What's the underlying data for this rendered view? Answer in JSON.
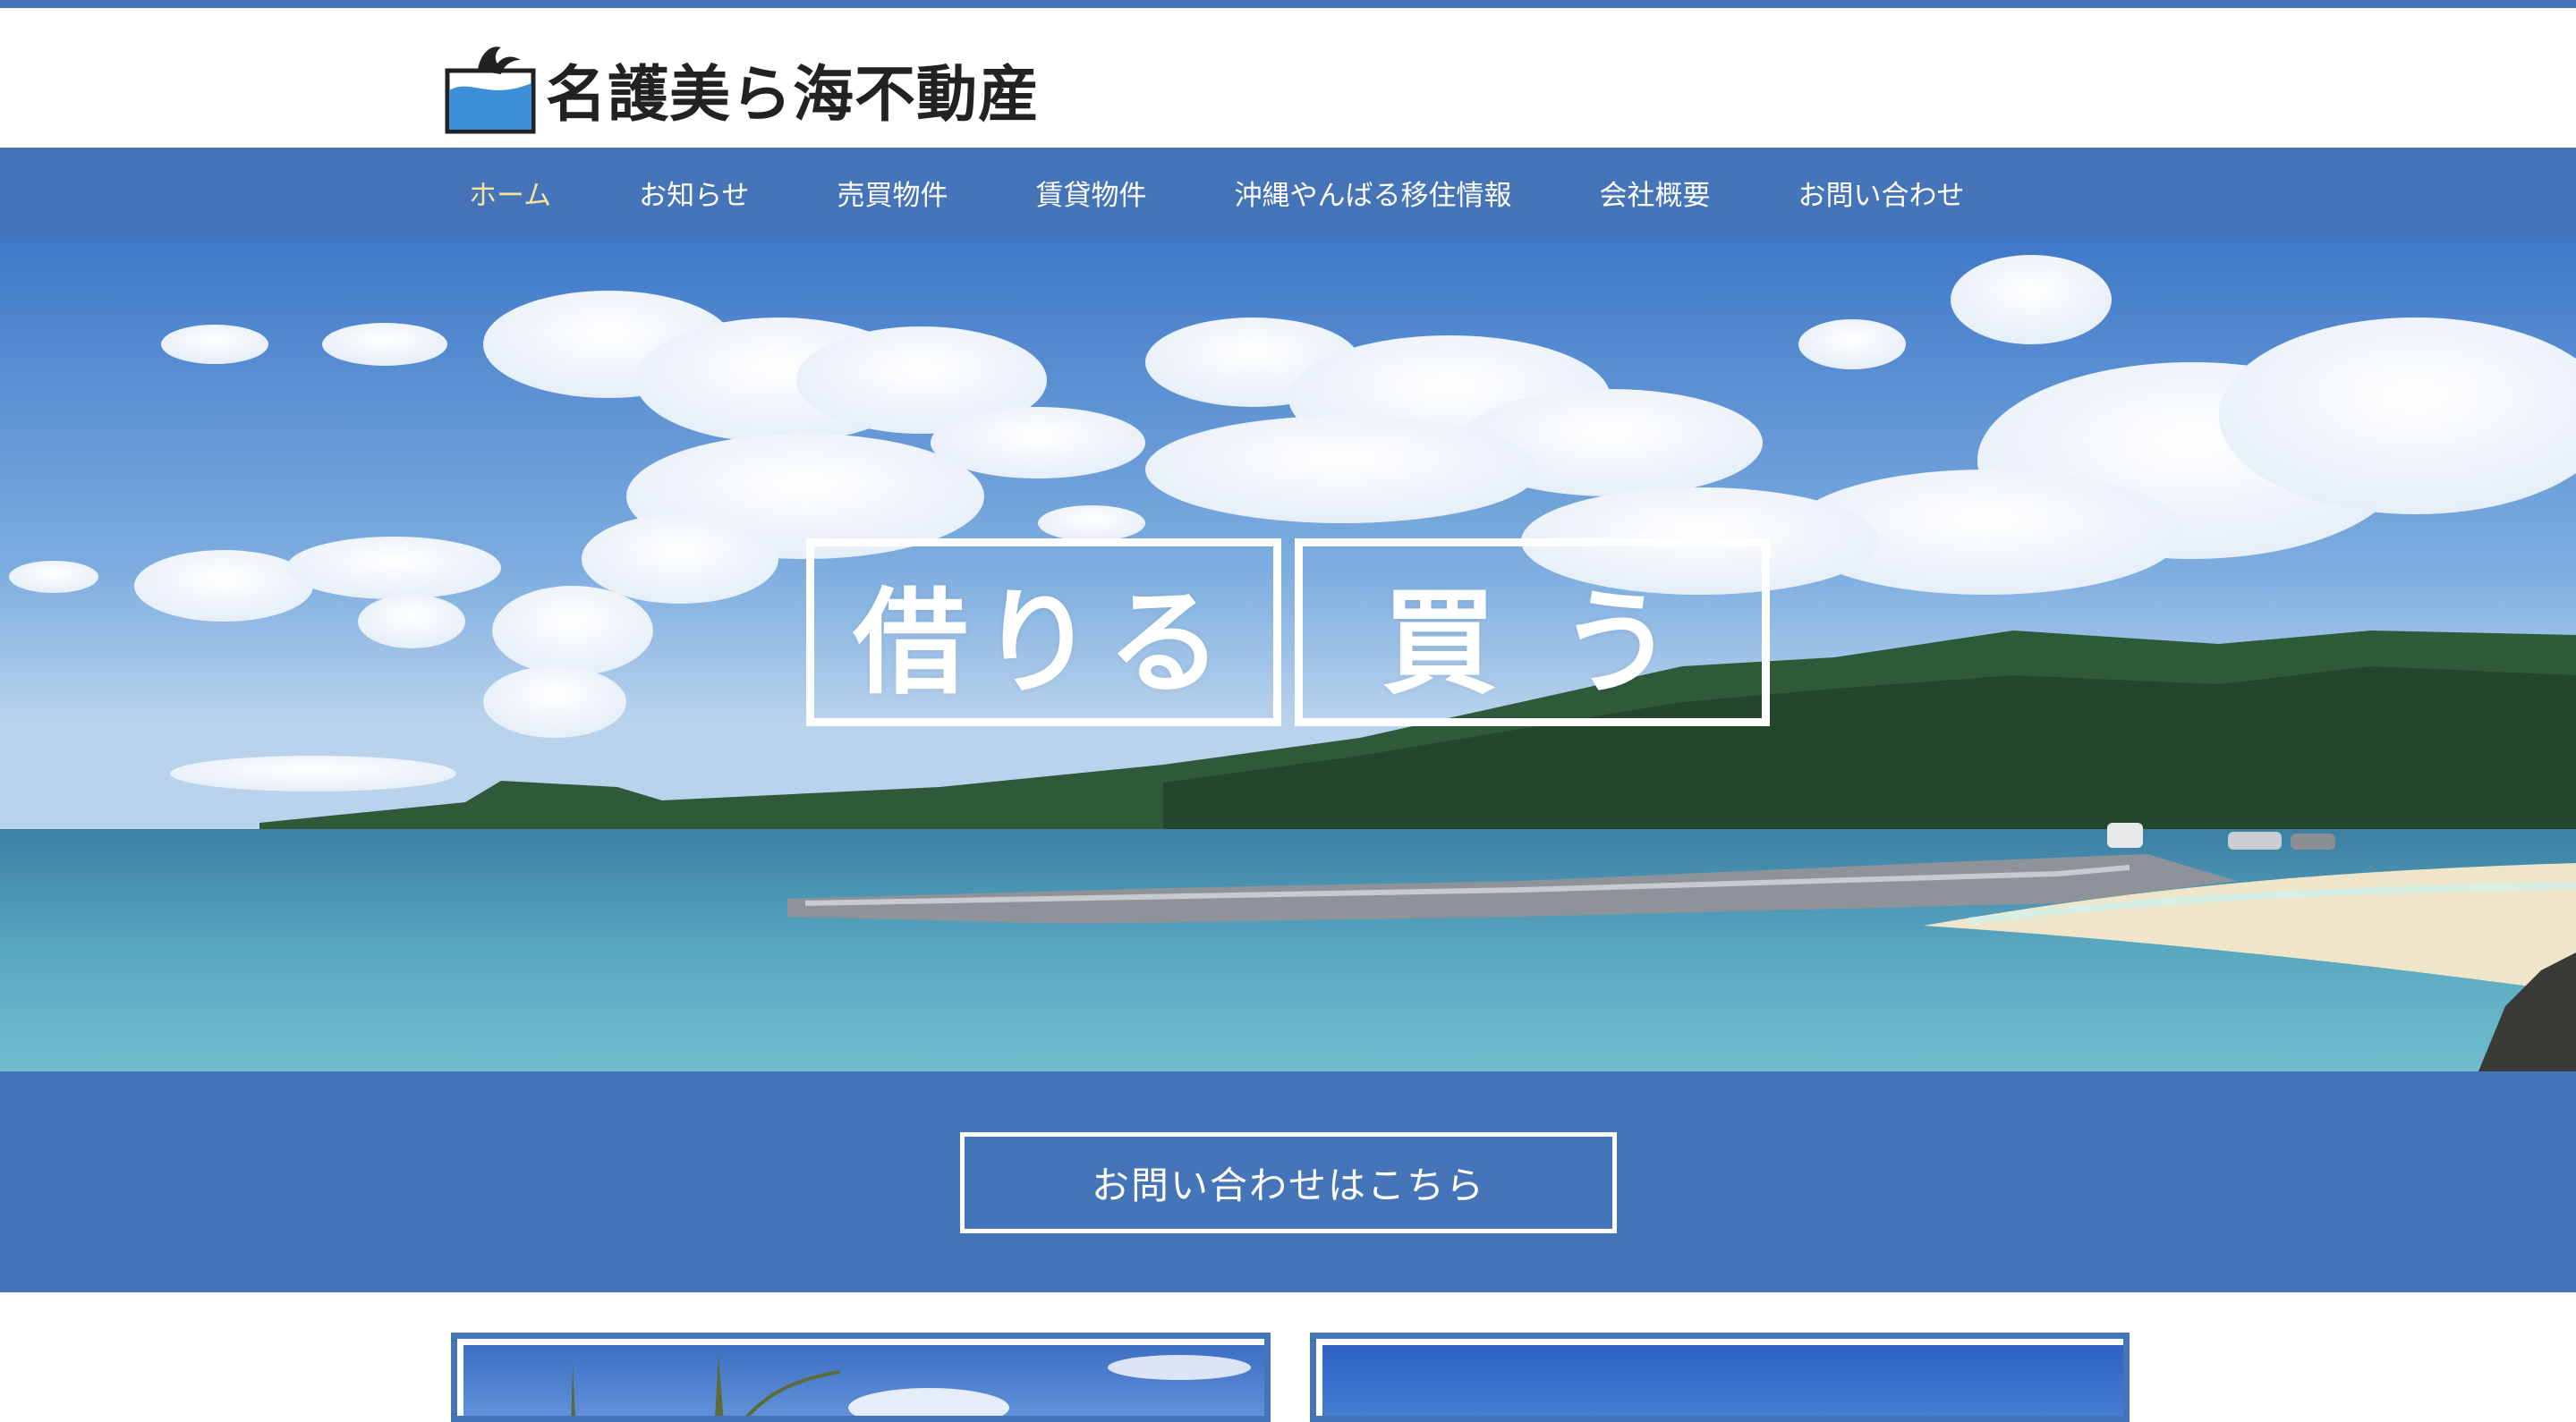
{
  "header": {
    "logo_text": "名護美ら海不動産"
  },
  "nav": {
    "items": [
      {
        "label": "ホーム",
        "active": true
      },
      {
        "label": "お知らせ",
        "active": false
      },
      {
        "label": "売買物件",
        "active": false
      },
      {
        "label": "賃貸物件",
        "active": false
      },
      {
        "label": "沖縄やんばる移住情報",
        "active": false
      },
      {
        "label": "会社概要",
        "active": false
      },
      {
        "label": "お問い合わせ",
        "active": false
      }
    ]
  },
  "hero": {
    "rent_label": "借りる",
    "buy_label": "買う"
  },
  "cta": {
    "label": "お問い合わせはこちら"
  },
  "colors": {
    "brand_blue": "#4674b9",
    "nav_active": "#f4e39b"
  }
}
